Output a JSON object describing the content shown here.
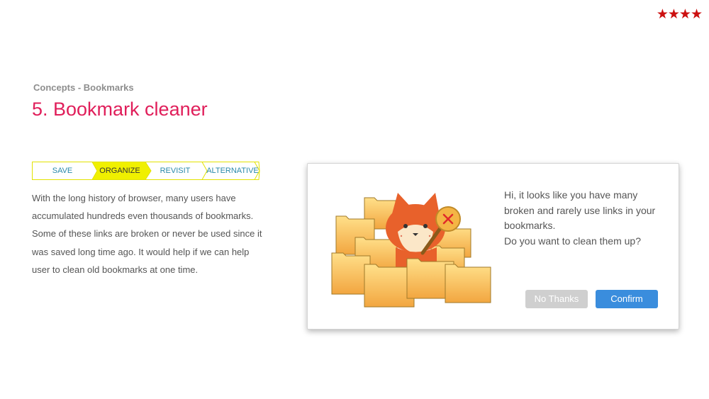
{
  "rating": "★★★★",
  "breadcrumb": "Concepts - Bookmarks",
  "title": "5. Bookmark cleaner",
  "steps": [
    {
      "label": "SAVE",
      "active": false
    },
    {
      "label": "ORGANIZE",
      "active": true
    },
    {
      "label": "REVISIT",
      "active": false
    },
    {
      "label": "ALTERNATIVE",
      "active": false
    }
  ],
  "description": "With the long history of browser, many users have accumulated hundreds even thousands of bookmarks. Some of these links are broken or never be used since it was saved long time ago. It would help if we can help user to clean old bookmarks at one time.",
  "dialog": {
    "message_lines": [
      "Hi, it looks like you have many",
      "broken and rarely use links in your",
      "bookmarks.",
      "Do you want to clean them up?"
    ],
    "no_thanks_label": "No Thanks",
    "confirm_label": "Confirm"
  },
  "colors": {
    "title": "#e01e5a",
    "active_step": "#f0f000",
    "step_text": "#2a8aaa",
    "confirm": "#3a8ddd",
    "no_thanks": "#cfcfcf",
    "rating": "#cc1010"
  },
  "icons": {
    "illustration": "fox-with-folders-icon",
    "rating": "star-icon"
  }
}
